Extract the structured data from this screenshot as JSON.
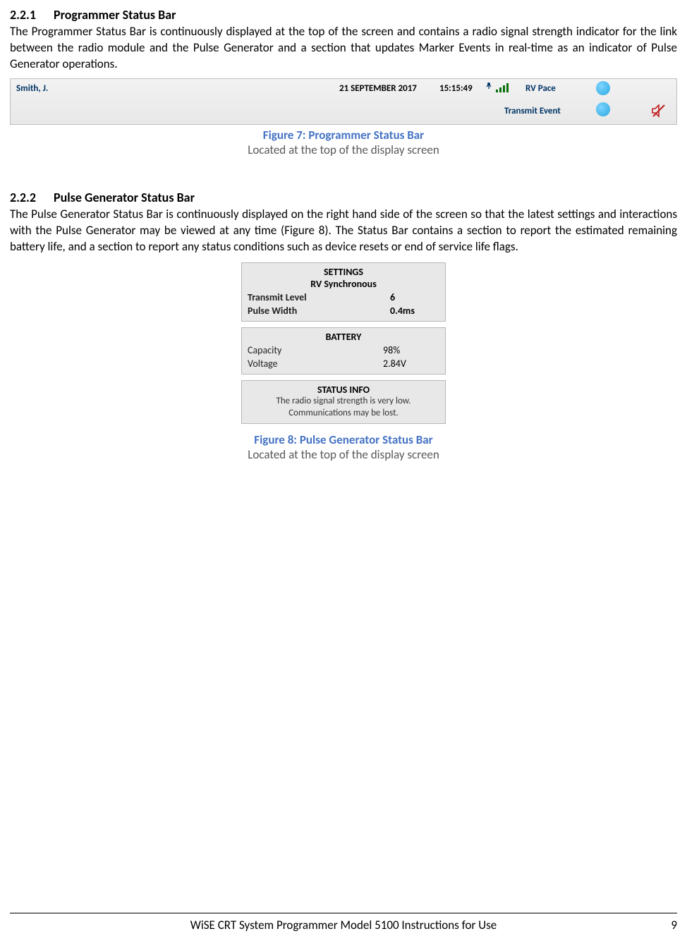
{
  "section221": {
    "num": "2.2.1",
    "title": "Programmer Status Bar",
    "para": "The Programmer Status Bar is continuously displayed at the top of the screen and contains a radio signal strength indicator for the link between the radio module and the Pulse Generator and a section that updates Marker Events in real-time as an indicator of Pulse Generator operations."
  },
  "fig7": {
    "caption_title": "Figure 7: Programmer Status Bar",
    "caption_sub": "Located at the top of the display screen",
    "patient": "Smith, J.",
    "date": "21 SEPTEMBER 2017",
    "time": "15:15:49",
    "rv_pace": "RV Pace",
    "transmit_event": "Transmit Event"
  },
  "section222": {
    "num": "2.2.2",
    "title": "Pulse Generator Status Bar",
    "para": "The Pulse Generator Status Bar is continuously displayed on the right hand side of the screen so that the latest settings and interactions with the Pulse Generator may be viewed at any time (Figure 8).  The Status Bar contains a section to report the estimated remaining battery life, and a section to report any status conditions such as device resets or end of service life flags."
  },
  "fig8": {
    "caption_title": "Figure 8: Pulse Generator Status Bar",
    "caption_sub": "Located at the top of the display screen",
    "settings": {
      "title": "SETTINGS",
      "mode": "RV Synchronous",
      "transmit_level_label": "Transmit Level",
      "transmit_level_value": "6",
      "pulse_width_label": "Pulse Width",
      "pulse_width_value": "0.4ms"
    },
    "battery": {
      "title": "BATTERY",
      "capacity_label": "Capacity",
      "capacity_value": "98%",
      "voltage_label": "Voltage",
      "voltage_value": "2.84V"
    },
    "status_info": {
      "title": "STATUS INFO",
      "message": "The radio signal strength is very low.  Communications may be lost."
    }
  },
  "footer": {
    "text": "WiSE CRT System Programmer Model 5100 Instructions for Use",
    "page": "9"
  }
}
